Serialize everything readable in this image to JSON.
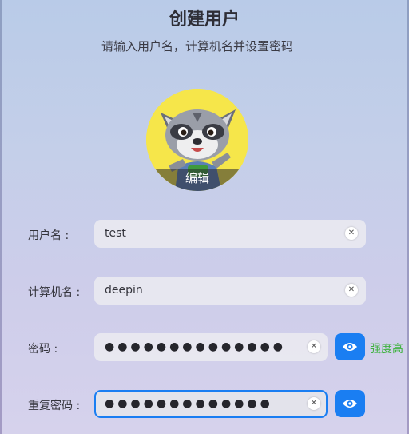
{
  "page": {
    "title": "创建用户",
    "subtitle": "请输入用户名，计算机名并设置密码"
  },
  "avatar": {
    "edit_label": "编辑"
  },
  "form": {
    "username": {
      "label": "用户名 :",
      "value": "test"
    },
    "computer_name": {
      "label": "计算机名 :",
      "value": "deepin"
    },
    "password": {
      "label": "密码 :",
      "masked_value": "●●●●●●●●●●●●●●",
      "strength": "强度高"
    },
    "confirm_password": {
      "label": "重复密码 :",
      "masked_value": "●●●●●●●●●●●●●"
    }
  },
  "icons": {
    "clear": "clear-icon",
    "show_password": "eye-icon"
  },
  "colors": {
    "accent": "#1a7ef2",
    "strength_ok": "#3db23d"
  }
}
